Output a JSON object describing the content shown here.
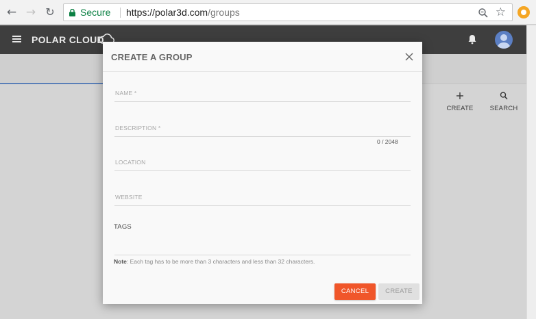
{
  "browser": {
    "secure_label": "Secure",
    "url_scheme_host": "https://polar3d.com",
    "url_path": "/groups"
  },
  "header": {
    "brand": "POLAR CLOUD",
    "icons": [
      "menu-icon",
      "cloud-icon",
      "bell-icon",
      "avatar"
    ]
  },
  "page": {
    "actions": {
      "create_label": "CREATE",
      "search_label": "SEARCH"
    }
  },
  "modal": {
    "title": "CREATE A GROUP",
    "fields": {
      "name_label": "NAME *",
      "description_label": "DESCRIPTION *",
      "description_counter": "0 / 2048",
      "location_label": "LOCATION",
      "website_label": "WEBSITE",
      "tags_label": "TAGS"
    },
    "note_prefix": "Note",
    "note_text": ": Each tag has to be more than 3 characters and less than 32 characters.",
    "cancel_label": "CANCEL",
    "create_label": "CREATE"
  },
  "colors": {
    "cancel_button": "#f0562a",
    "header_bg": "#3e3e3e",
    "secure_green": "#0b8043",
    "tab_underline": "#5a7fb8"
  }
}
